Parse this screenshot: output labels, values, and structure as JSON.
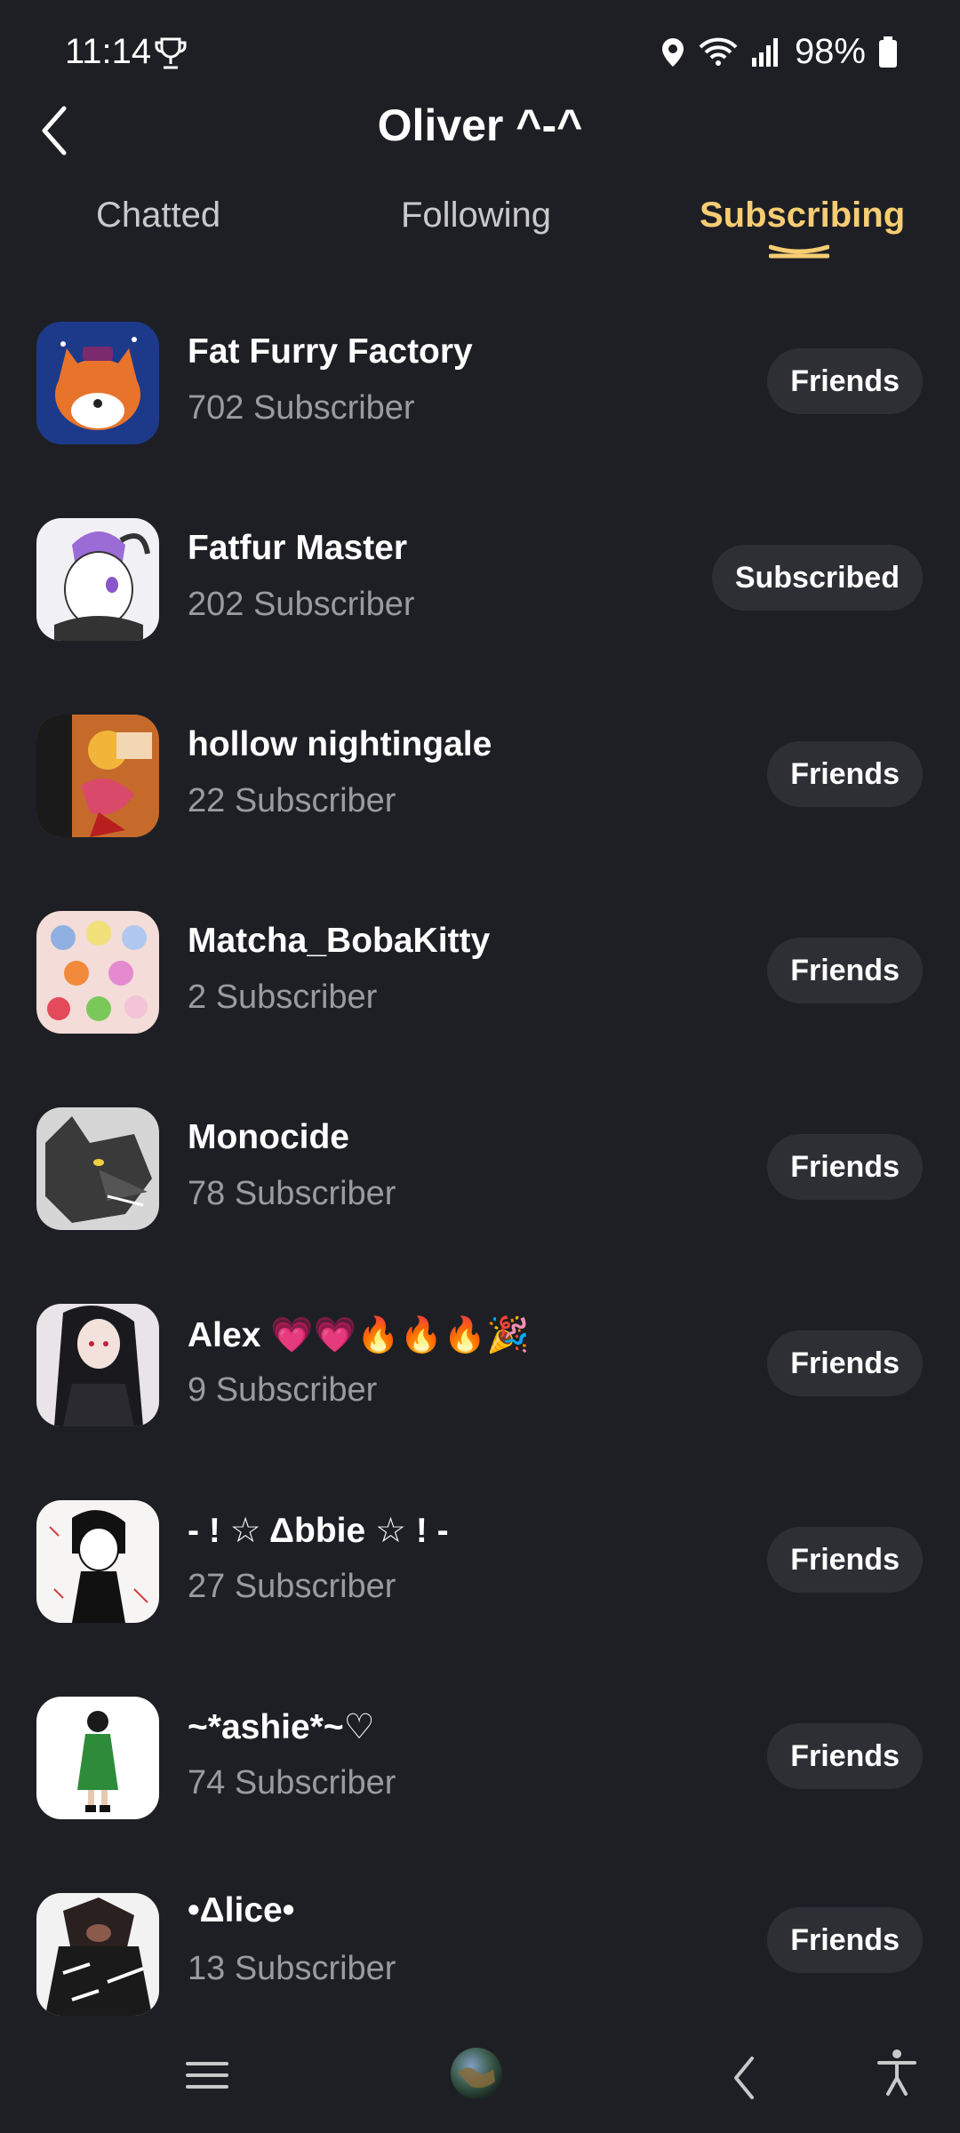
{
  "status_bar": {
    "time": "11:14",
    "battery": "98%"
  },
  "header": {
    "title": "Oliver ^-^"
  },
  "tabs": [
    {
      "label": "Chatted",
      "active": false
    },
    {
      "label": "Following",
      "active": false
    },
    {
      "label": "Subscribing",
      "active": true
    }
  ],
  "colors": {
    "background": "#1e1f24",
    "accent": "#f7cd73",
    "pill": "#2e2f35",
    "subtext": "#9a9ba0"
  },
  "list": [
    {
      "name": "Fat Furry Factory",
      "subscribers": "702 Subscriber",
      "button": "Friends"
    },
    {
      "name": "Fatfur Master",
      "subscribers": "202 Subscriber",
      "button": "Subscribed"
    },
    {
      "name": "hollow nightingale",
      "subscribers": "22 Subscriber",
      "button": "Friends"
    },
    {
      "name": "Matcha_BobaKitty",
      "subscribers": "2 Subscriber",
      "button": "Friends"
    },
    {
      "name": "Monocide",
      "subscribers": "78 Subscriber",
      "button": "Friends"
    },
    {
      "name": "Alex 💗💗🔥🔥🔥🎉",
      "subscribers": "9 Subscriber",
      "button": "Friends"
    },
    {
      "name": "- ! ☆ Δbbie ☆ ! -",
      "subscribers": "27 Subscriber",
      "button": "Friends"
    },
    {
      "name": "~*ashie*~♡",
      "subscribers": "74 Subscriber",
      "button": "Friends"
    },
    {
      "name": "•Δlice•",
      "subscribers": "13 Subscriber",
      "button": "Friends"
    }
  ],
  "nav": {
    "icons": [
      "menu-icon",
      "globe-icon",
      "back-icon",
      "accessibility-icon"
    ]
  }
}
